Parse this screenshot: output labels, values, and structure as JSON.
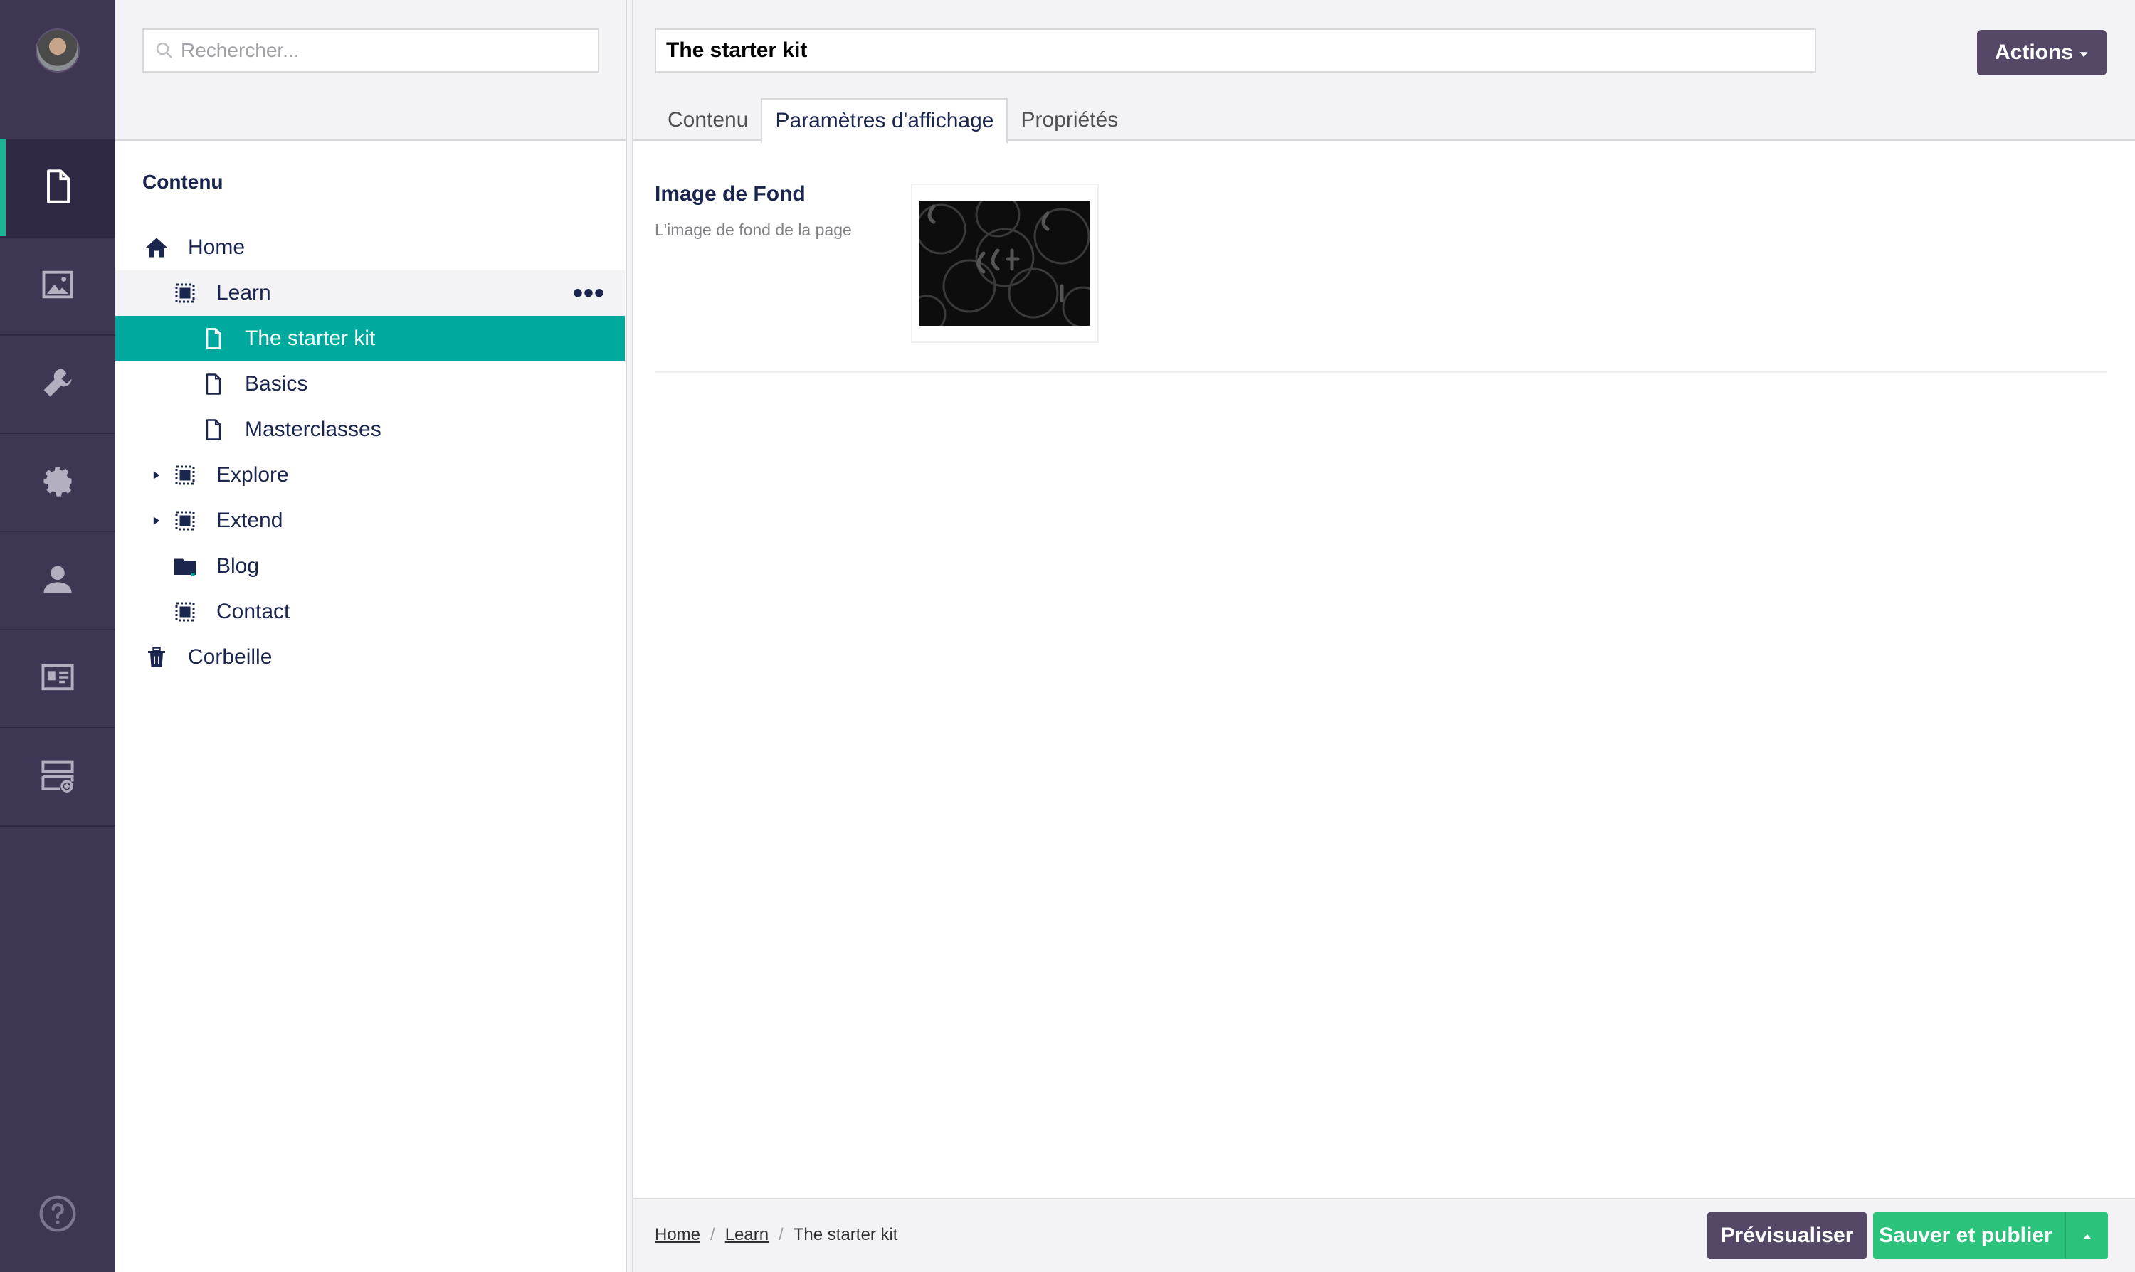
{
  "rail": {
    "items": [
      {
        "name": "content-icon",
        "active": true
      },
      {
        "name": "media-icon",
        "active": false
      },
      {
        "name": "settings-wrench-icon",
        "active": false
      },
      {
        "name": "gear-icon",
        "active": false
      },
      {
        "name": "user-icon",
        "active": false
      },
      {
        "name": "member-card-icon",
        "active": false
      },
      {
        "name": "forms-icon",
        "active": false
      }
    ],
    "help_icon": "help-icon"
  },
  "tree": {
    "search_placeholder": "Rechercher...",
    "title": "Contenu",
    "nodes": [
      {
        "label": "Home",
        "icon": "home-icon",
        "level": 0,
        "caret": false,
        "state": ""
      },
      {
        "label": "Learn",
        "icon": "section-icon",
        "level": 1,
        "caret": false,
        "state": "hover",
        "more": "•••"
      },
      {
        "label": "The starter kit",
        "icon": "page-icon",
        "level": 2,
        "caret": false,
        "state": "selected"
      },
      {
        "label": "Basics",
        "icon": "page-icon",
        "level": 2,
        "caret": false,
        "state": ""
      },
      {
        "label": "Masterclasses",
        "icon": "page-icon",
        "level": 2,
        "caret": false,
        "state": ""
      },
      {
        "label": "Explore",
        "icon": "section-icon",
        "level": 1,
        "caret": true,
        "state": ""
      },
      {
        "label": "Extend",
        "icon": "section-icon",
        "level": 1,
        "caret": true,
        "state": ""
      },
      {
        "label": "Blog",
        "icon": "folder-icon",
        "level": 1,
        "caret": false,
        "state": ""
      },
      {
        "label": "Contact",
        "icon": "section-icon",
        "level": 1,
        "caret": false,
        "state": ""
      },
      {
        "label": "Corbeille",
        "icon": "trash-icon",
        "level": 0,
        "caret": false,
        "state": ""
      }
    ]
  },
  "editor": {
    "name_value": "The starter kit",
    "actions_label": "Actions",
    "tabs": [
      {
        "label": "Contenu",
        "active": false
      },
      {
        "label": "Paramètres d'affichage",
        "active": true
      },
      {
        "label": "Propriétés",
        "active": false
      }
    ],
    "property": {
      "label": "Image de Fond",
      "description": "L'image de fond de la page"
    }
  },
  "footer": {
    "breadcrumb": {
      "home": "Home",
      "learn": "Learn",
      "current": "The starter kit",
      "sep": "/"
    },
    "preview_label": "Prévisualiser",
    "publish_label": "Sauver et publier"
  },
  "colors": {
    "rail": "#3f3654",
    "accent": "#00a99d",
    "publish": "#2bc37c",
    "button": "#544866"
  }
}
